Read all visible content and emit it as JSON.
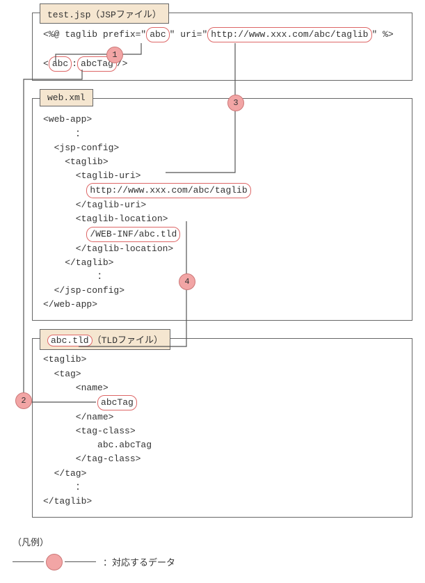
{
  "files": {
    "jsp": {
      "title": "test.jsp（JSPファイル）",
      "taglib_open": "<%@ taglib prefix=\"",
      "prefix": "abc",
      "mid": "\" uri=\"",
      "uri": "http://www.xxx.com/abc/taglib",
      "close": "\" %>",
      "tag_open": "<",
      "tag_prefix": "abc",
      "sep": ":",
      "tag_name": "abcTag",
      "tag_close": "/>"
    },
    "web": {
      "title": "web.xml",
      "l1": "<web-app>",
      "l2": "      ：",
      "l3": "  <jsp-config>",
      "l4": "    <taglib>",
      "l5": "      <taglib-uri>",
      "uri": "http://www.xxx.com/abc/taglib",
      "l6": "      </taglib-uri>",
      "l7": "      <taglib-location>",
      "loc": "/WEB-INF/abc.tld",
      "l8": "      </taglib-location>",
      "l9": "    </taglib>",
      "l10": "          ：",
      "l11": "  </jsp-config>",
      "l12": "</web-app>"
    },
    "tld": {
      "title_pre": "abc.tld",
      "title_post": "（TLDファイル）",
      "l1": "<taglib>",
      "l2": "  <tag>",
      "l3": "      <name>",
      "name": "abcTag",
      "l4": "      </name>",
      "l5": "      <tag-class>",
      "l6": "          abc.abcTag",
      "l7": "      </tag-class>",
      "l8": "  </tag>",
      "l9": "      ：",
      "l10": "</taglib>"
    }
  },
  "numbers": {
    "n1": "1",
    "n2": "2",
    "n3": "3",
    "n4": "4"
  },
  "legend": {
    "title": "（凡例）",
    "label": "：対応するデータ"
  }
}
